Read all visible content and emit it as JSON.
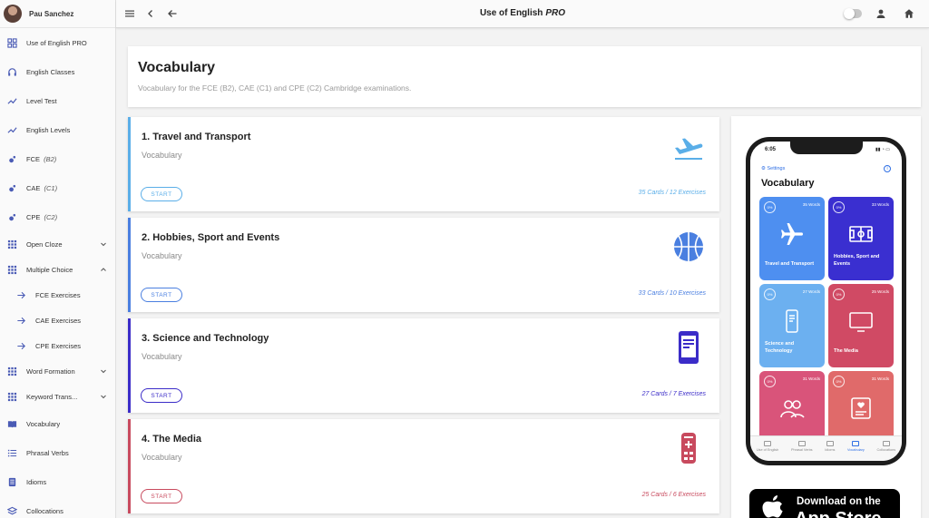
{
  "user": {
    "name": "Pau Sanchez"
  },
  "sidebar": {
    "items": [
      {
        "label": "Use of English PRO"
      },
      {
        "label": "English Classes"
      },
      {
        "label": "Level Test"
      },
      {
        "label": "English Levels"
      },
      {
        "label": "FCE",
        "level": "(B2)"
      },
      {
        "label": "CAE",
        "level": "(C1)"
      },
      {
        "label": "CPE",
        "level": "(C2)"
      },
      {
        "label": "Open Cloze"
      },
      {
        "label": "Multiple Choice"
      },
      {
        "label": "FCE Exercises"
      },
      {
        "label": "CAE Exercises"
      },
      {
        "label": "CPE Exercises"
      },
      {
        "label": "Word Formation"
      },
      {
        "label": "Keyword Trans..."
      },
      {
        "label": "Vocabulary"
      },
      {
        "label": "Phrasal Verbs"
      },
      {
        "label": "Idioms"
      },
      {
        "label": "Collocations"
      }
    ]
  },
  "topbar": {
    "title": "Use of English",
    "title_suffix": "PRO"
  },
  "header": {
    "title": "Vocabulary",
    "subtitle": "Vocabulary for the FCE (B2), CAE (C1) and CPE (C2) Cambridge examinations."
  },
  "topics": [
    {
      "title": "1. Travel and Transport",
      "subtitle": "Vocabulary",
      "button": "START",
      "cards": "35 Cards",
      "sep": " / ",
      "exercises": "12 Exercises",
      "color": "#5aaee8",
      "icon": "plane-departure-icon"
    },
    {
      "title": "2. Hobbies, Sport and Events",
      "subtitle": "Vocabulary",
      "button": "START",
      "cards": "33 Cards",
      "sep": " / ",
      "exercises": "10 Exercises",
      "color": "#4a7fe0",
      "icon": "basketball-icon"
    },
    {
      "title": "3. Science and Technology",
      "subtitle": "Vocabulary",
      "button": "START",
      "cards": "27 Cards",
      "sep": " / ",
      "exercises": "7 Exercises",
      "color": "#3b2cc8",
      "icon": "smartphone-icon"
    },
    {
      "title": "4. The Media",
      "subtitle": "Vocabulary",
      "button": "START",
      "cards": "25 Cards",
      "sep": " / ",
      "exercises": "6 Exercises",
      "color": "#c84a5e",
      "icon": "remote-control-icon"
    }
  ],
  "phone": {
    "time": "6:05",
    "settings": "Settings",
    "title": "Vocabulary",
    "tiles": [
      {
        "pct": "0%",
        "words": "35 Words",
        "label": "Travel and Transport",
        "color": "#4e8ff0",
        "icon": "plane-icon"
      },
      {
        "pct": "0%",
        "words": "33 Words",
        "label": "Hobbies, Sport and Events",
        "color": "#3a2fd0",
        "icon": "stadium-icon"
      },
      {
        "pct": "0%",
        "words": "27 Words",
        "label": "Science and Technology",
        "color": "#6cb0f0",
        "icon": "phone-icon"
      },
      {
        "pct": "0%",
        "words": "25 Words",
        "label": "The Media",
        "color": "#d04a64",
        "icon": "tv-icon"
      },
      {
        "pct": "0%",
        "words": "31 Words",
        "label": "",
        "color": "#d9547a",
        "icon": "people-icon"
      },
      {
        "pct": "0%",
        "words": "31 Words",
        "label": "",
        "color": "#e06a6a",
        "icon": "card-icon"
      }
    ],
    "tabs": [
      "Use of English",
      "Phrasal Verbs",
      "Idioms",
      "Vocabulary",
      "Collocations"
    ]
  },
  "appstore": {
    "line1": "Download on the",
    "line2": "App Store"
  }
}
